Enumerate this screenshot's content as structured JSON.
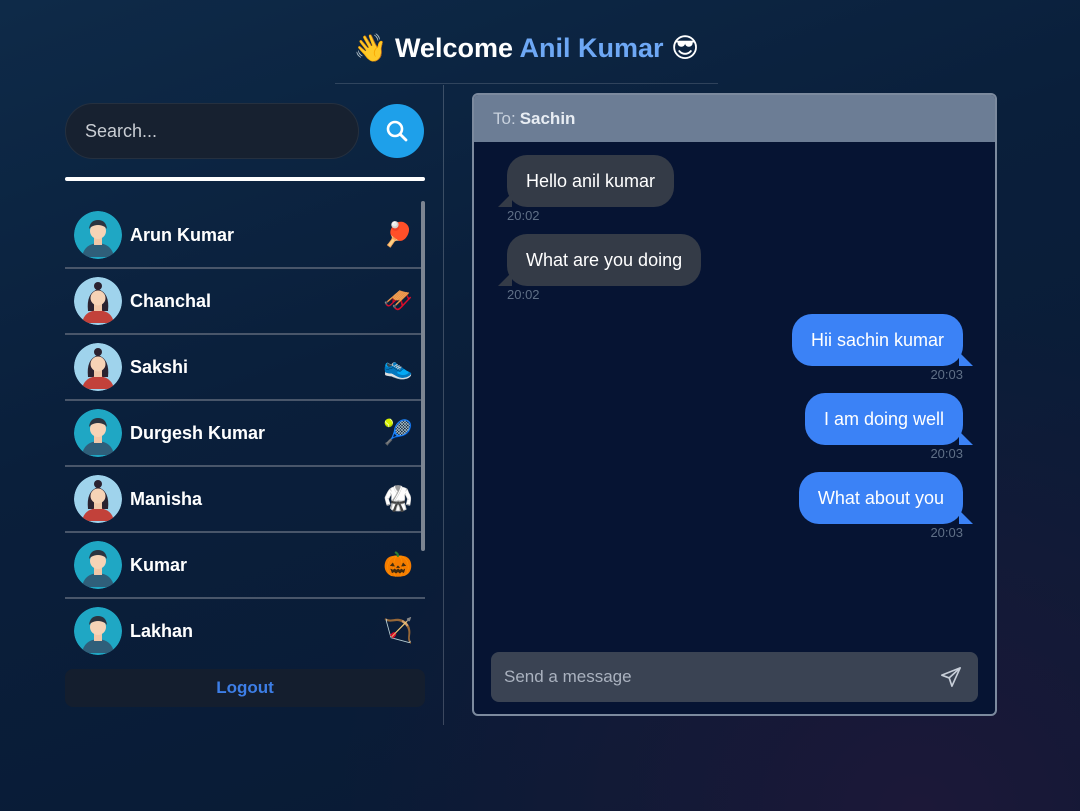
{
  "header": {
    "wave_emoji": "👋",
    "welcome": "Welcome",
    "user_name": "Anil Kumar",
    "cool_emoji": "😎"
  },
  "search": {
    "placeholder": "Search..."
  },
  "contacts": [
    {
      "name": "Arun Kumar",
      "icon": "🏓",
      "avatar": "male"
    },
    {
      "name": "Chanchal",
      "icon": "🛷",
      "avatar": "female"
    },
    {
      "name": "Sakshi",
      "icon": "👟",
      "avatar": "female"
    },
    {
      "name": "Durgesh Kumar",
      "icon": "🎾",
      "avatar": "male"
    },
    {
      "name": "Manisha",
      "icon": "🥋",
      "avatar": "female"
    },
    {
      "name": "Kumar",
      "icon": "🎃",
      "avatar": "male"
    },
    {
      "name": "Lakhan",
      "icon": "🏹",
      "avatar": "male"
    }
  ],
  "logout_label": "Logout",
  "chat": {
    "to_label": "To:",
    "to_name": "Sachin",
    "messages": [
      {
        "text": "Hello anil kumar",
        "time": "20:02",
        "direction": "in"
      },
      {
        "text": "What are you doing",
        "time": "20:02",
        "direction": "in"
      },
      {
        "text": "Hii sachin kumar",
        "time": "20:03",
        "direction": "out"
      },
      {
        "text": "I am doing well",
        "time": "20:03",
        "direction": "out"
      },
      {
        "text": "What about you",
        "time": "20:03",
        "direction": "out"
      }
    ],
    "input_placeholder": "Send a message"
  },
  "colors": {
    "accent": "#6ea8f5",
    "search_button": "#1ea0ea",
    "outgoing_bubble": "#3b82f6",
    "incoming_bubble": "#343b47",
    "logout_text": "#3d7ee6"
  }
}
